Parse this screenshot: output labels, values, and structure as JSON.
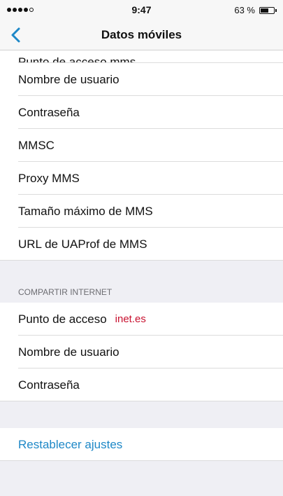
{
  "status_bar": {
    "time": "9:47",
    "battery_percent": "63 %",
    "battery_level": 0.63,
    "signal_bars": 4,
    "signal_total": 5
  },
  "nav": {
    "back_icon": "chevron-left-icon",
    "title": "Datos móviles"
  },
  "mms_section": {
    "items": [
      {
        "label": "Punto de acceso  mms"
      },
      {
        "label": "Nombre de usuario"
      },
      {
        "label": "Contraseña"
      },
      {
        "label": "MMSC"
      },
      {
        "label": "Proxy MMS"
      },
      {
        "label": "Tamaño máximo de MMS"
      },
      {
        "label": "URL de UAProf de MMS"
      }
    ]
  },
  "tethering_section": {
    "header": "COMPARTIR INTERNET",
    "items": [
      {
        "label": "Punto de acceso",
        "value": "inet.es"
      },
      {
        "label": "Nombre de usuario"
      },
      {
        "label": "Contraseña"
      }
    ]
  },
  "reset": {
    "label": "Restablecer ajustes"
  },
  "colors": {
    "accent": "#1e88c7",
    "value_red": "#c8102e",
    "group_bg": "#efeff4"
  }
}
